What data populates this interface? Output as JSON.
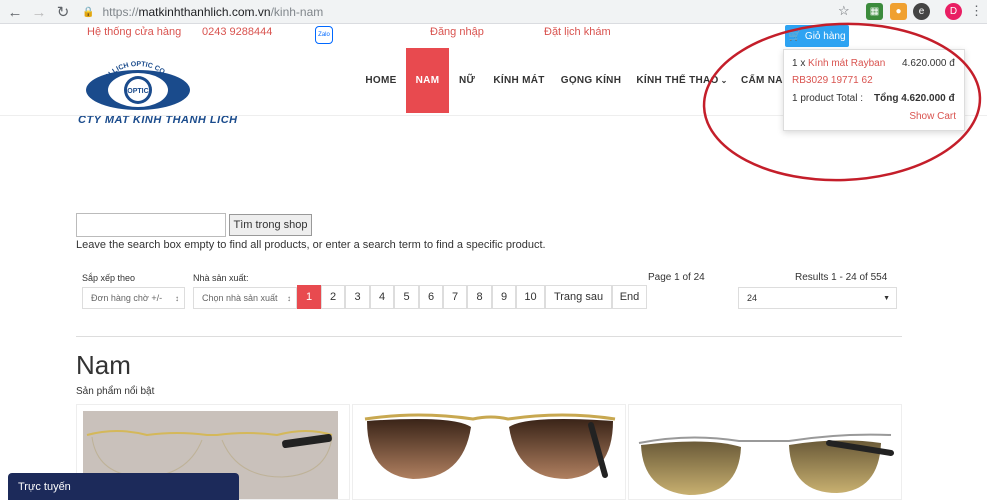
{
  "browser": {
    "url_prefix": "https://",
    "url_host": "matkinhthanhlich.com.vn",
    "url_path": "/kinh-nam",
    "profile_initial": "D"
  },
  "topbar": {
    "store_system": "Hệ thống cửa hàng",
    "phone": "0243 9288444",
    "zalo": "Zalo",
    "login": "Đăng nhập",
    "booking": "Đặt lịch khám"
  },
  "logo": {
    "ring_text": "THANH LICH OPTIC CO., LTD",
    "center_text": "OPTIC",
    "company_name": "CTY MAT KINH THANH LICH"
  },
  "menu": {
    "home": "HOME",
    "men": "NAM",
    "women": "NỮ",
    "sunglasses": "KÍNH MÁT",
    "frames": "GỌNG KÍNH",
    "sport": "KÍNH THỂ THAO",
    "guide": "CẨM NA"
  },
  "cart": {
    "button_label": "Giỏ hàng",
    "item_qty": "1 x",
    "item_name": "Kính mát Rayban",
    "item_price": "4.620.000 đ",
    "item_code": "RB3029 19771 62",
    "total_prefix": "1 product Total :",
    "total_value": "Tổng 4.620.000 đ",
    "show_cart": "Show Cart"
  },
  "search": {
    "input_value": "",
    "button_label": "Tìm trong shop",
    "help_text": "Leave the search box empty to find all products, or enter a search term to find a specific product."
  },
  "filters": {
    "sort_label": "Sắp xếp theo",
    "sort_value": "Đơn hàng chờ +/-",
    "manufacturer_label": "Nhà sản xuất:",
    "manufacturer_value": "Chọn nhà sản xuất",
    "page_info": "Page 1 of 24",
    "results_info": "Results 1 - 24 of 554",
    "per_page_value": "24"
  },
  "pagination": {
    "pages": [
      "1",
      "2",
      "3",
      "4",
      "5",
      "6",
      "7",
      "8",
      "9",
      "10"
    ],
    "next": "Trang sau",
    "end": "End"
  },
  "content": {
    "title": "Nam",
    "featured": "Sản phẩm nổi bật"
  },
  "chat": {
    "label": "Trực tuyến"
  },
  "colors": {
    "accent": "#e84a4f",
    "cart_blue": "#2ea3f2",
    "brand_blue": "#1a4b8c",
    "annotation_red": "#c41e2a"
  }
}
